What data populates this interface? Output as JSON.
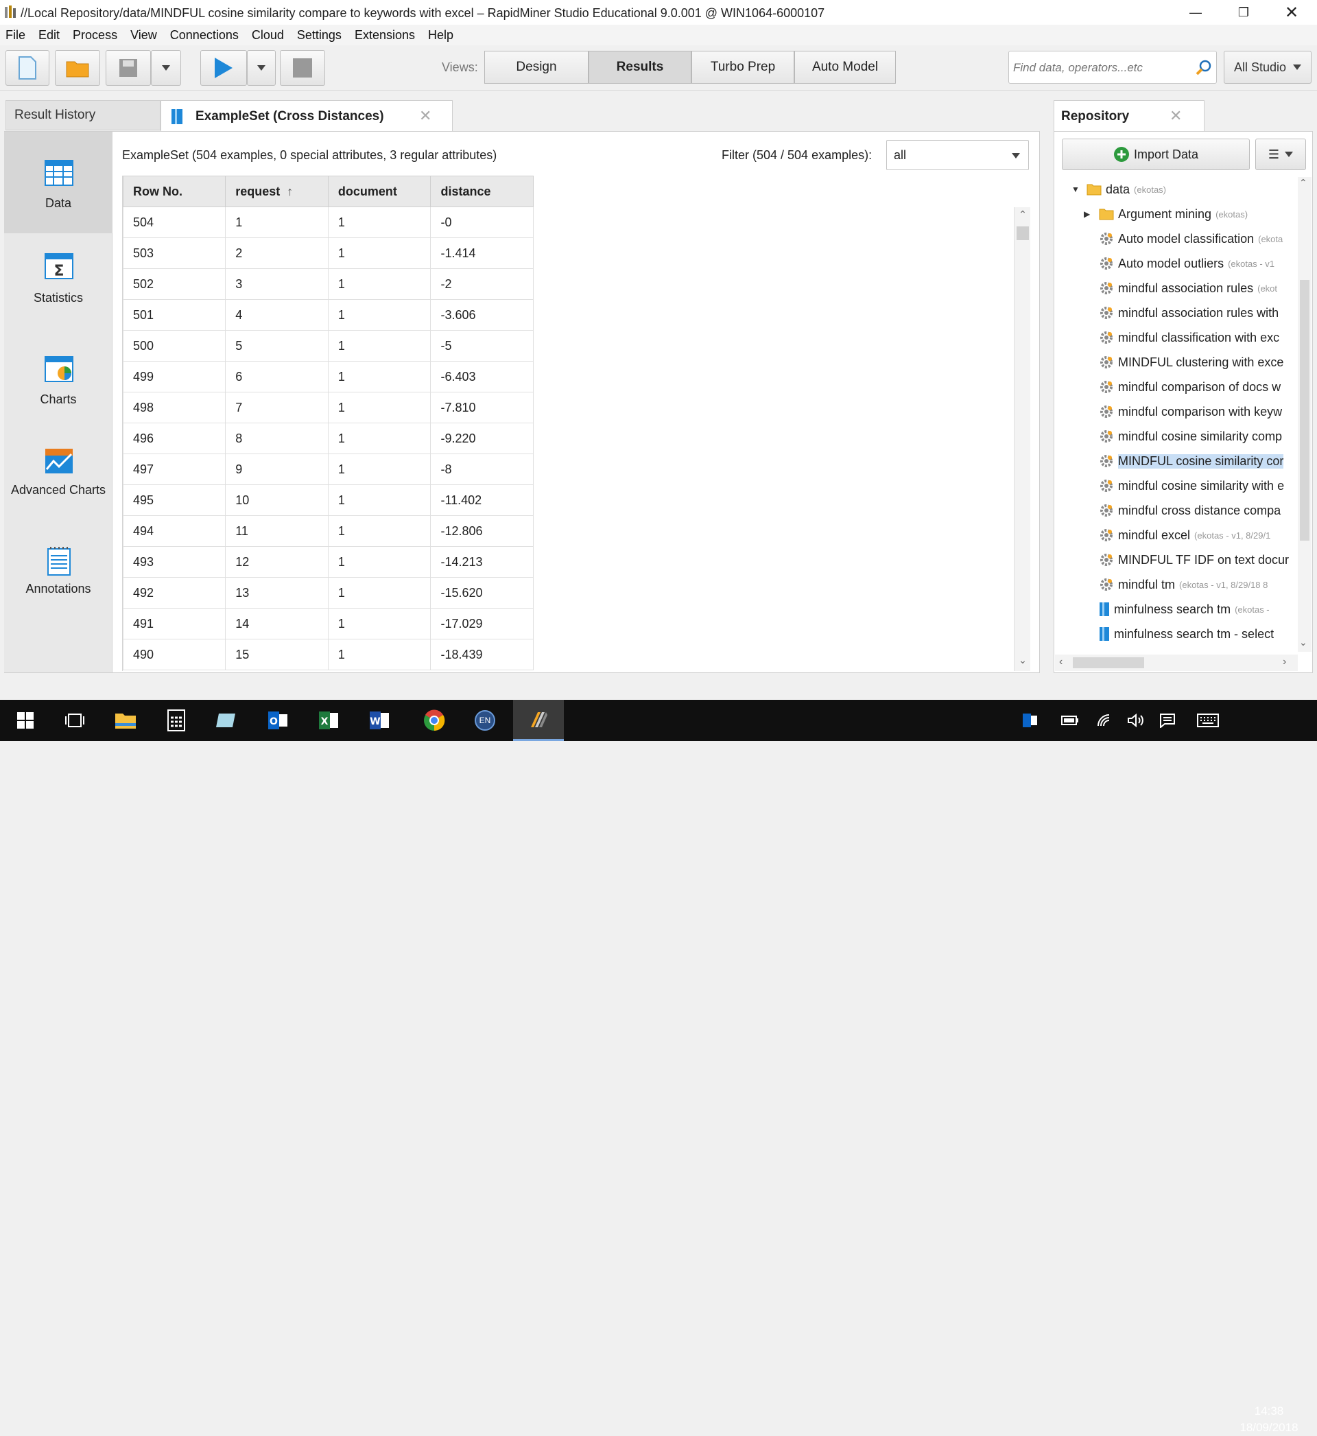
{
  "window": {
    "title": "//Local Repository/data/MINDFUL cosine similarity compare to keywords with excel – RapidMiner Studio Educational 9.0.001 @ WIN1064-6000107"
  },
  "menu": [
    "File",
    "Edit",
    "Process",
    "View",
    "Connections",
    "Cloud",
    "Settings",
    "Extensions",
    "Help"
  ],
  "toolbar": {
    "views_label": "Views:",
    "views": [
      "Design",
      "Results",
      "Turbo Prep",
      "Auto Model"
    ],
    "active_view": "Results",
    "search_placeholder": "Find data, operators...etc",
    "scope": "All Studio",
    "run_color": "#1e88d8"
  },
  "tabs": {
    "history": "Result History",
    "exampleset": "ExampleSet (Cross Distances)"
  },
  "sidebar": {
    "items": [
      {
        "label": "Data",
        "icon": "table-icon"
      },
      {
        "label": "Statistics",
        "icon": "statistics-icon"
      },
      {
        "label": "Charts",
        "icon": "charts-icon"
      },
      {
        "label": "Advanced Charts",
        "icon": "advanced-charts-icon"
      },
      {
        "label": "Annotations",
        "icon": "annotations-icon"
      }
    ]
  },
  "exampleset": {
    "info": "ExampleSet (504 examples, 0 special attributes, 3 regular attributes)",
    "filter_label": "Filter (504 / 504 examples):",
    "filter_value": "all",
    "columns": [
      "Row No.",
      "request",
      "document",
      "distance"
    ],
    "rows": [
      [
        "504",
        "1",
        "1",
        "-0"
      ],
      [
        "503",
        "2",
        "1",
        "-1.414"
      ],
      [
        "502",
        "3",
        "1",
        "-2"
      ],
      [
        "501",
        "4",
        "1",
        "-3.606"
      ],
      [
        "500",
        "5",
        "1",
        "-5"
      ],
      [
        "499",
        "6",
        "1",
        "-6.403"
      ],
      [
        "498",
        "7",
        "1",
        "-7.810"
      ],
      [
        "496",
        "8",
        "1",
        "-9.220"
      ],
      [
        "497",
        "9",
        "1",
        "-8"
      ],
      [
        "495",
        "10",
        "1",
        "-11.402"
      ],
      [
        "494",
        "11",
        "1",
        "-12.806"
      ],
      [
        "493",
        "12",
        "1",
        "-14.213"
      ],
      [
        "492",
        "13",
        "1",
        "-15.620"
      ],
      [
        "491",
        "14",
        "1",
        "-17.029"
      ],
      [
        "490",
        "15",
        "1",
        "-18.439"
      ]
    ]
  },
  "repository": {
    "title": "Repository",
    "import_label": "Import Data",
    "items": [
      {
        "label": "data",
        "meta": "(ekotas)",
        "type": "folder",
        "expanded": true,
        "level": 0
      },
      {
        "label": "Argument mining",
        "meta": "(ekotas)",
        "type": "folder",
        "expanded": false,
        "level": 1
      },
      {
        "label": "Auto model classification",
        "meta": "(ekota",
        "type": "process",
        "level": 1
      },
      {
        "label": "Auto model outliers",
        "meta": "(ekotas - v1",
        "type": "process",
        "level": 1
      },
      {
        "label": "mindful association rules",
        "meta": "(ekot",
        "type": "process",
        "level": 1
      },
      {
        "label": "mindful association rules with",
        "meta": "",
        "type": "process",
        "level": 1
      },
      {
        "label": "mindful classification with exc",
        "meta": "",
        "type": "process",
        "level": 1
      },
      {
        "label": "MINDFUL clustering with exce",
        "meta": "",
        "type": "process",
        "level": 1
      },
      {
        "label": "mindful comparison of docs w",
        "meta": "",
        "type": "process",
        "level": 1
      },
      {
        "label": "mindful comparison with keyw",
        "meta": "",
        "type": "process",
        "level": 1
      },
      {
        "label": "mindful cosine similarity comp",
        "meta": "",
        "type": "process",
        "level": 1
      },
      {
        "label": "MINDFUL cosine similarity cor",
        "meta": "",
        "type": "process",
        "level": 1,
        "selected": true
      },
      {
        "label": "mindful cosine similarity with e",
        "meta": "",
        "type": "process",
        "level": 1
      },
      {
        "label": "mindful cross distance compa",
        "meta": "",
        "type": "process",
        "level": 1
      },
      {
        "label": "mindful excel",
        "meta": "(ekotas - v1, 8/29/1",
        "type": "process",
        "level": 1
      },
      {
        "label": "MINDFUL TF IDF on text docur",
        "meta": "",
        "type": "process",
        "level": 1
      },
      {
        "label": "mindful tm",
        "meta": "(ekotas - v1, 8/29/18 8",
        "type": "process",
        "level": 1
      },
      {
        "label": "minfulness search tm",
        "meta": "(ekotas -",
        "type": "data",
        "level": 1
      },
      {
        "label": "minfulness search tm - select",
        "meta": "",
        "type": "data",
        "level": 1
      }
    ]
  },
  "taskbar": {
    "language": "EN",
    "time": "14:38",
    "date": "18/09/2018"
  }
}
